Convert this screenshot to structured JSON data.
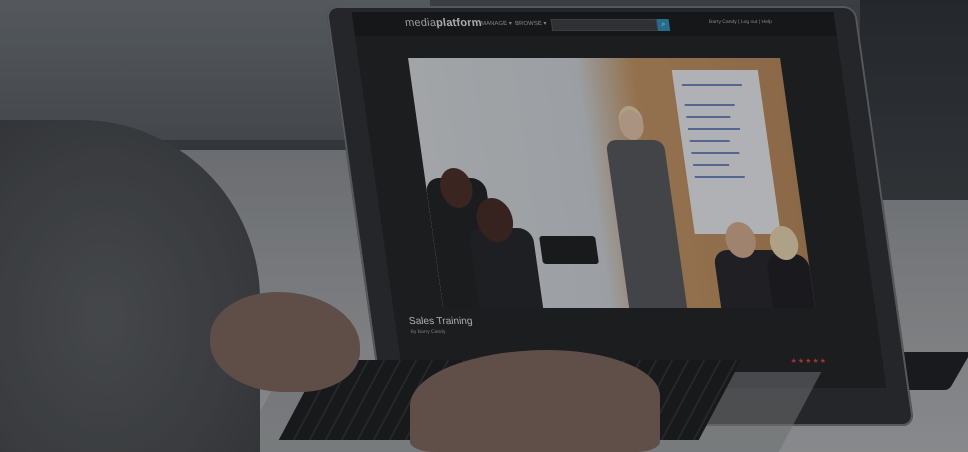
{
  "app": {
    "logo_prefix": "media",
    "logo_suffix": "platform",
    "nav": [
      {
        "label": "MANAGE ▾"
      },
      {
        "label": "BROWSE ▾"
      }
    ],
    "search": {
      "value": "",
      "button_icon": "search-icon"
    },
    "user": {
      "name": "Barry Candy",
      "logout": "Log out",
      "help": "Help"
    }
  },
  "video": {
    "title": "Sales Training",
    "byline": "By Barry Candy",
    "rating_stars": 5,
    "rating_text": "★★★★★"
  },
  "colors": {
    "accent": "#2e8fb7",
    "stars": "#d8413f",
    "screen_bg": "#1f2022"
  }
}
